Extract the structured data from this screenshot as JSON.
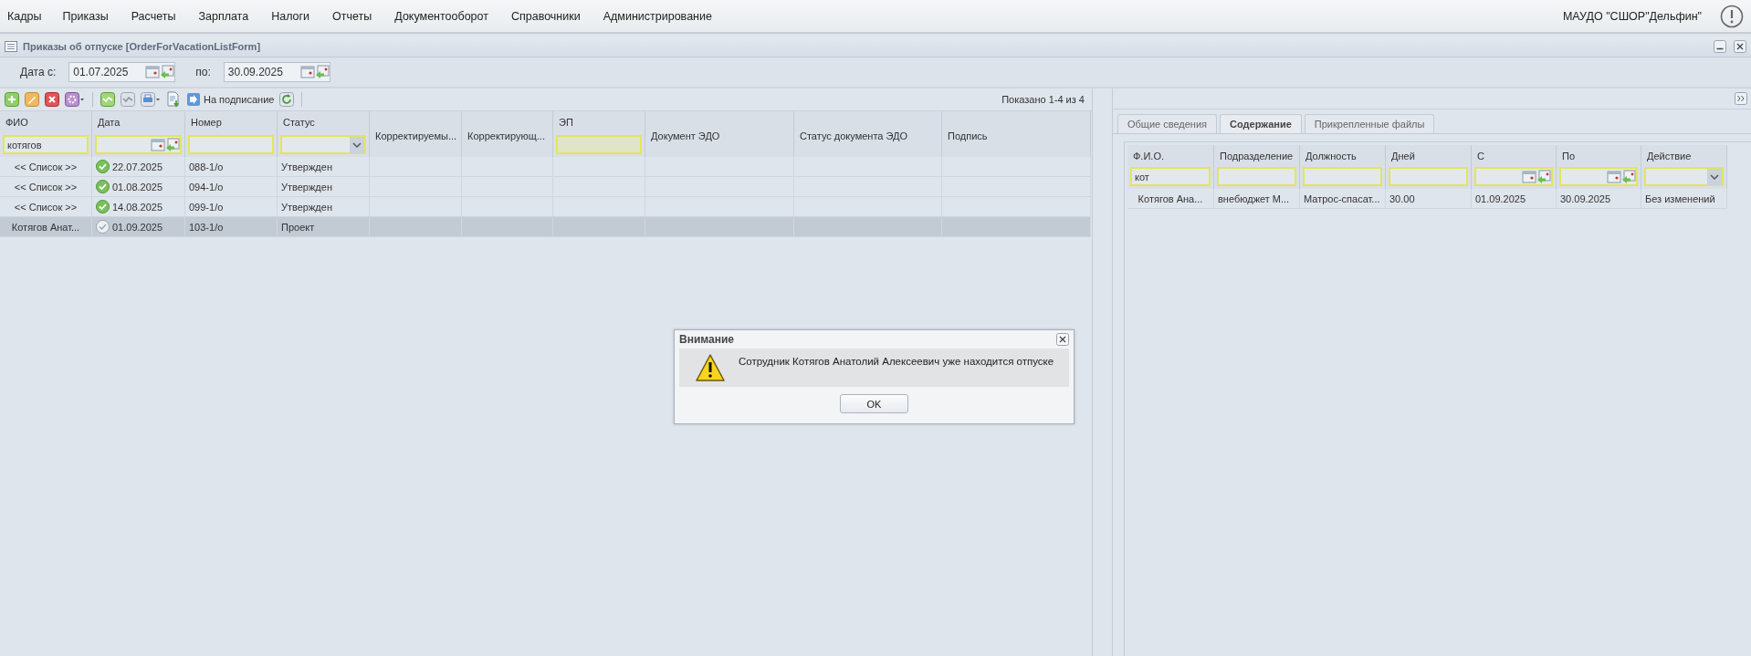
{
  "menu": {
    "items": [
      "Кадры",
      "Приказы",
      "Расчеты",
      "Зарплата",
      "Налоги",
      "Отчеты",
      "Документооборот",
      "Справочники",
      "Администрирование"
    ],
    "org": "МАУДО \"СШОР\"Дельфин\""
  },
  "window": {
    "title": "Приказы об отпуске [OrderForVacationListForm]"
  },
  "date_filter": {
    "from_label": "Дата с:",
    "from": "01.07.2025",
    "to_label": "по:",
    "to": "30.09.2025"
  },
  "toolbar": [
    {
      "kind": "add"
    },
    {
      "kind": "edit"
    },
    {
      "kind": "delete"
    },
    {
      "kind": "settings"
    },
    {
      "kind": "sep"
    },
    {
      "kind": "approve"
    },
    {
      "kind": "unapprove"
    },
    {
      "kind": "print"
    },
    {
      "kind": "export"
    },
    {
      "kind": "sign",
      "label": "На подписание"
    },
    {
      "kind": "refresh"
    },
    {
      "kind": "sep"
    }
  ],
  "paging": "Показано 1-4 из 4",
  "table": {
    "columns": [
      {
        "label": "ФИО",
        "kind": "text",
        "value": "котягов"
      },
      {
        "label": "Дата",
        "kind": "date"
      },
      {
        "label": "Номер",
        "kind": "text"
      },
      {
        "label": "Статус",
        "kind": "select"
      },
      {
        "label": "Корректируемы...",
        "kind": "plain"
      },
      {
        "label": "Корректирующ...",
        "kind": "plain"
      },
      {
        "label": "ЭП",
        "kind": "flag"
      },
      {
        "label": "Документ ЭДО",
        "kind": "plain"
      },
      {
        "label": "Статус документа ЭДО",
        "kind": "plain"
      },
      {
        "label": "Подпись",
        "kind": "plain"
      }
    ],
    "rows": [
      {
        "fio": "<< Список >>",
        "approved": true,
        "date": "22.07.2025",
        "number": "088-1/о",
        "status": "Утвержден",
        "selected": false
      },
      {
        "fio": "<< Список >>",
        "approved": true,
        "date": "01.08.2025",
        "number": "094-1/о",
        "status": "Утвержден",
        "selected": false
      },
      {
        "fio": "<< Список >>",
        "approved": true,
        "date": "14.08.2025",
        "number": "099-1/о",
        "status": "Утвержден",
        "selected": false
      },
      {
        "fio": "Котягов Анат...",
        "approved": false,
        "date": "01.09.2025",
        "number": "103-1/о",
        "status": "Проект",
        "selected": true
      }
    ]
  },
  "detail": {
    "tabs": [
      {
        "label": "Общие сведения",
        "selected": false
      },
      {
        "label": "Содержание",
        "selected": true
      },
      {
        "label": "Прикрепленные файлы",
        "selected": false
      }
    ],
    "columns": [
      {
        "label": "Ф.И.О.",
        "kind": "text",
        "value": "кот"
      },
      {
        "label": "Подразделение",
        "kind": "text"
      },
      {
        "label": "Должность",
        "kind": "text"
      },
      {
        "label": "Дней",
        "kind": "text"
      },
      {
        "label": "С",
        "kind": "date"
      },
      {
        "label": "По",
        "kind": "date"
      },
      {
        "label": "Действие",
        "kind": "select"
      }
    ],
    "rows": [
      [
        "Котягов Ана...",
        "внебюджет М...",
        "Матрос-спасат...",
        "30.00",
        "01.09.2025",
        "30.09.2025",
        "Без изменений"
      ]
    ]
  },
  "dialog": {
    "title": "Внимание",
    "message": "Сотрудник Котягов Анатолий Алексеевич уже находится отпуске",
    "button": "OK"
  }
}
